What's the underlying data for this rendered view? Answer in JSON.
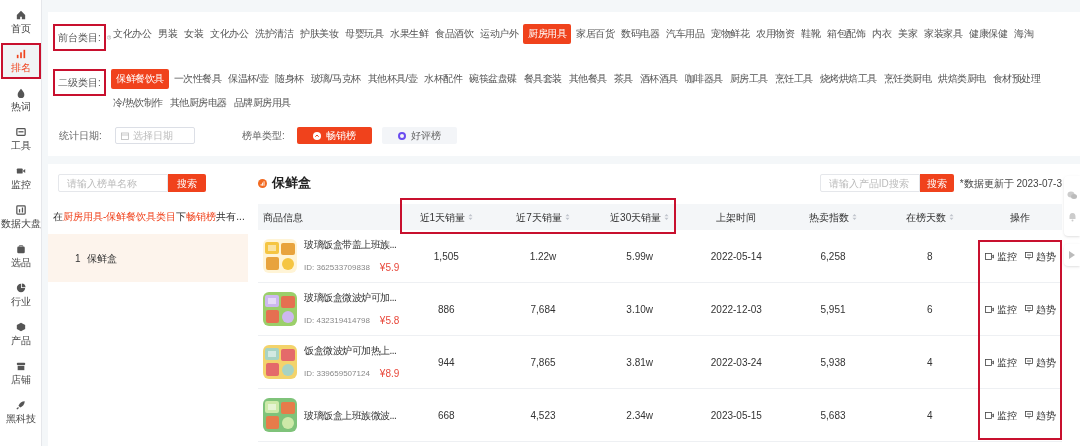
{
  "sidebar": {
    "items": [
      {
        "label": "首页",
        "selected": false
      },
      {
        "label": "排名",
        "selected": true
      },
      {
        "label": "热词",
        "selected": false
      },
      {
        "label": "工具",
        "selected": false
      },
      {
        "label": "监控",
        "selected": false
      },
      {
        "label": "数据大盘",
        "selected": false
      },
      {
        "label": "选品",
        "selected": false
      },
      {
        "label": "行业",
        "selected": false
      },
      {
        "label": "产品",
        "selected": false
      },
      {
        "label": "店铺",
        "selected": false
      },
      {
        "label": "黑科技",
        "selected": false
      }
    ]
  },
  "filters": {
    "front_category": {
      "label": "前台类目:",
      "items": [
        {
          "label": "文化办公",
          "selected": false
        },
        {
          "label": "男装",
          "selected": false
        },
        {
          "label": "女装",
          "selected": false
        },
        {
          "label": "文化办公",
          "selected": false
        },
        {
          "label": "洗护清洁",
          "selected": false
        },
        {
          "label": "护肤美妆",
          "selected": false
        },
        {
          "label": "母婴玩具",
          "selected": false
        },
        {
          "label": "水果生鲜",
          "selected": false
        },
        {
          "label": "食品酒饮",
          "selected": false
        },
        {
          "label": "运动户外",
          "selected": false
        },
        {
          "label": "厨房用具",
          "selected": true
        },
        {
          "label": "家居百货",
          "selected": false
        },
        {
          "label": "数码电器",
          "selected": false
        },
        {
          "label": "汽车用品",
          "selected": false
        },
        {
          "label": "宠物鲜花",
          "selected": false
        },
        {
          "label": "农用物资",
          "selected": false
        },
        {
          "label": "鞋靴",
          "selected": false
        },
        {
          "label": "箱包配饰",
          "selected": false
        },
        {
          "label": "内衣",
          "selected": false
        },
        {
          "label": "美家",
          "selected": false
        },
        {
          "label": "家装家具",
          "selected": false
        },
        {
          "label": "健康保健",
          "selected": false
        },
        {
          "label": "海淘",
          "selected": false
        }
      ]
    },
    "second_category": {
      "label": "二级类目:",
      "items": [
        {
          "label": "保鲜餐饮具",
          "selected": true
        },
        {
          "label": "一次性餐具",
          "selected": false
        },
        {
          "label": "保温杯/壶",
          "selected": false
        },
        {
          "label": "随身杯",
          "selected": false
        },
        {
          "label": "玻璃/马克杯",
          "selected": false
        },
        {
          "label": "其他杯具/壶",
          "selected": false
        },
        {
          "label": "水杯配件",
          "selected": false
        },
        {
          "label": "碗筷盆盘碟",
          "selected": false
        },
        {
          "label": "餐具套装",
          "selected": false
        },
        {
          "label": "其他餐具",
          "selected": false
        },
        {
          "label": "茶具",
          "selected": false
        },
        {
          "label": "酒杯酒具",
          "selected": false
        },
        {
          "label": "咖啡器具",
          "selected": false
        },
        {
          "label": "厨房工具",
          "selected": false
        },
        {
          "label": "烹饪工具",
          "selected": false
        },
        {
          "label": "烧烤烘焙工具",
          "selected": false
        },
        {
          "label": "烹饪类厨电",
          "selected": false
        },
        {
          "label": "烘焙类厨电",
          "selected": false
        },
        {
          "label": "食材预处理",
          "selected": false
        },
        {
          "label": "冷/热饮制作",
          "selected": false
        },
        {
          "label": "其他厨房电器",
          "selected": false
        },
        {
          "label": "品牌厨房用具",
          "selected": false
        }
      ]
    },
    "date": {
      "label": "统计日期:",
      "placeholder": "选择日期"
    },
    "list_type": {
      "label": "榜单类型:",
      "options": [
        {
          "label": "畅销榜",
          "selected": true
        },
        {
          "label": "好评榜",
          "selected": false
        }
      ]
    }
  },
  "ranking_panel": {
    "search": {
      "placeholder": "请输入榜单名称",
      "button": "搜索"
    },
    "summary": [
      {
        "text": "在",
        "highlight": false
      },
      {
        "text": "厨房用具-保鲜餐饮具类目",
        "highlight": true
      },
      {
        "text": "下",
        "highlight": false
      },
      {
        "text": "畅销榜",
        "highlight": true
      },
      {
        "text": "共有...",
        "highlight": false
      }
    ],
    "lists": [
      {
        "rank": "1",
        "name": "保鲜盒",
        "selected": true
      }
    ]
  },
  "product_panel": {
    "title": "保鲜盒",
    "search": {
      "placeholder": "请输入产品ID搜索",
      "button": "搜索"
    },
    "update_note": "*数据更新于 2023-07-3",
    "table": {
      "columns": [
        {
          "label": "商品信息",
          "sortable": false
        },
        {
          "label": "近1天销量",
          "sortable": true
        },
        {
          "label": "近7天销量",
          "sortable": true
        },
        {
          "label": "近30天销量",
          "sortable": true
        },
        {
          "label": "上架时间",
          "sortable": false
        },
        {
          "label": "热卖指数",
          "sortable": true
        },
        {
          "label": "在榜天数",
          "sortable": true
        },
        {
          "label": "操作",
          "sortable": false
        }
      ],
      "rows": [
        {
          "product": {
            "title": "玻璃饭盒带盖上班族...",
            "id": "ID: 362533709838",
            "price": "¥5.9"
          },
          "sales_1d": "1,505",
          "sales_7d": "1.22w",
          "sales_30d": "5.99w",
          "listed_on": "2022-05-14",
          "hot_index": "6,258",
          "days_on_list": "8",
          "actions": [
            "监控",
            "趋势"
          ]
        },
        {
          "product": {
            "title": "玻璃饭盒微波炉可加...",
            "id": "ID: 432319414798",
            "price": "¥5.8"
          },
          "sales_1d": "886",
          "sales_7d": "7,684",
          "sales_30d": "3.10w",
          "listed_on": "2022-12-03",
          "hot_index": "5,951",
          "days_on_list": "6",
          "actions": [
            "监控",
            "趋势"
          ]
        },
        {
          "product": {
            "title": "饭盒微波炉可加热上...",
            "id": "ID: 339659507124",
            "price": "¥8.9"
          },
          "sales_1d": "944",
          "sales_7d": "7,865",
          "sales_30d": "3.81w",
          "listed_on": "2022-03-24",
          "hot_index": "5,938",
          "days_on_list": "4",
          "actions": [
            "监控",
            "趋势"
          ]
        },
        {
          "product": {
            "title": "玻璃饭盒上班族微波..."
          },
          "sales_1d": "668",
          "sales_7d": "4,523",
          "sales_30d": "2.34w",
          "listed_on": "2023-05-15",
          "hot_index": "5,683",
          "days_on_list": "4",
          "actions": [
            "监控",
            "趋势"
          ]
        }
      ]
    }
  }
}
